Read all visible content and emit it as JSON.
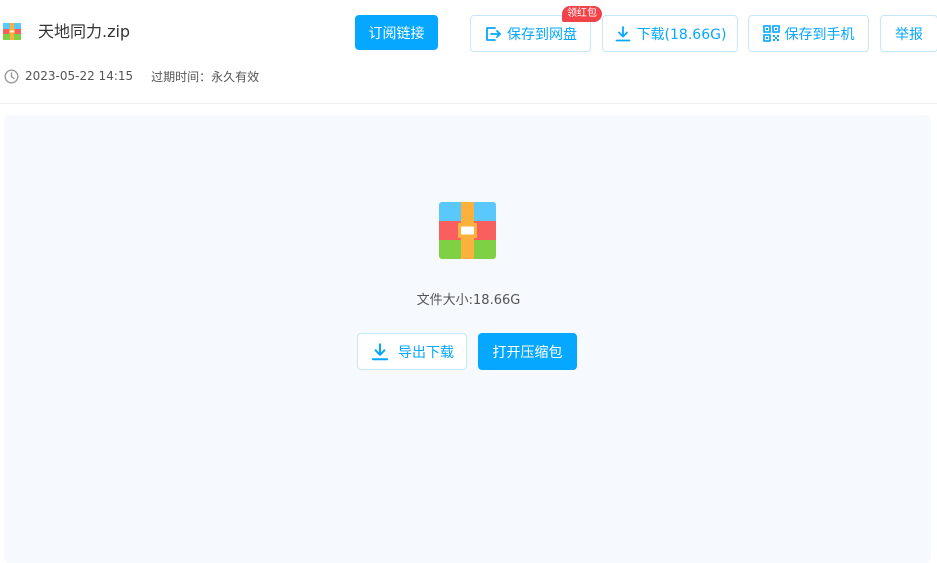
{
  "header": {
    "file_name": "天地同力.zip",
    "subscribe_label": "订阅链接",
    "save_cloud_label": "保存到网盘",
    "red_packet_badge": "领红包",
    "download_label": "下载(18.66G)",
    "save_phone_label": "保存到手机",
    "report_label": "举报"
  },
  "meta": {
    "date": "2023-05-22 14:15",
    "expire_label": "过期时间：永久有效"
  },
  "preview": {
    "file_size": "文件大小:18.66G",
    "export_download_label": "导出下载",
    "open_archive_label": "打开压缩包"
  },
  "colors": {
    "accent": "#06a7ff",
    "badge": "#f0434a",
    "zip_blue": "#5ac8fa",
    "zip_red": "#f95f5f",
    "zip_green": "#7ed144",
    "zip_strap": "#fdb13d"
  },
  "icons": [
    "zip-file-icon",
    "clock-icon",
    "save-to-cloud-icon",
    "download-icon",
    "qr-code-icon"
  ]
}
